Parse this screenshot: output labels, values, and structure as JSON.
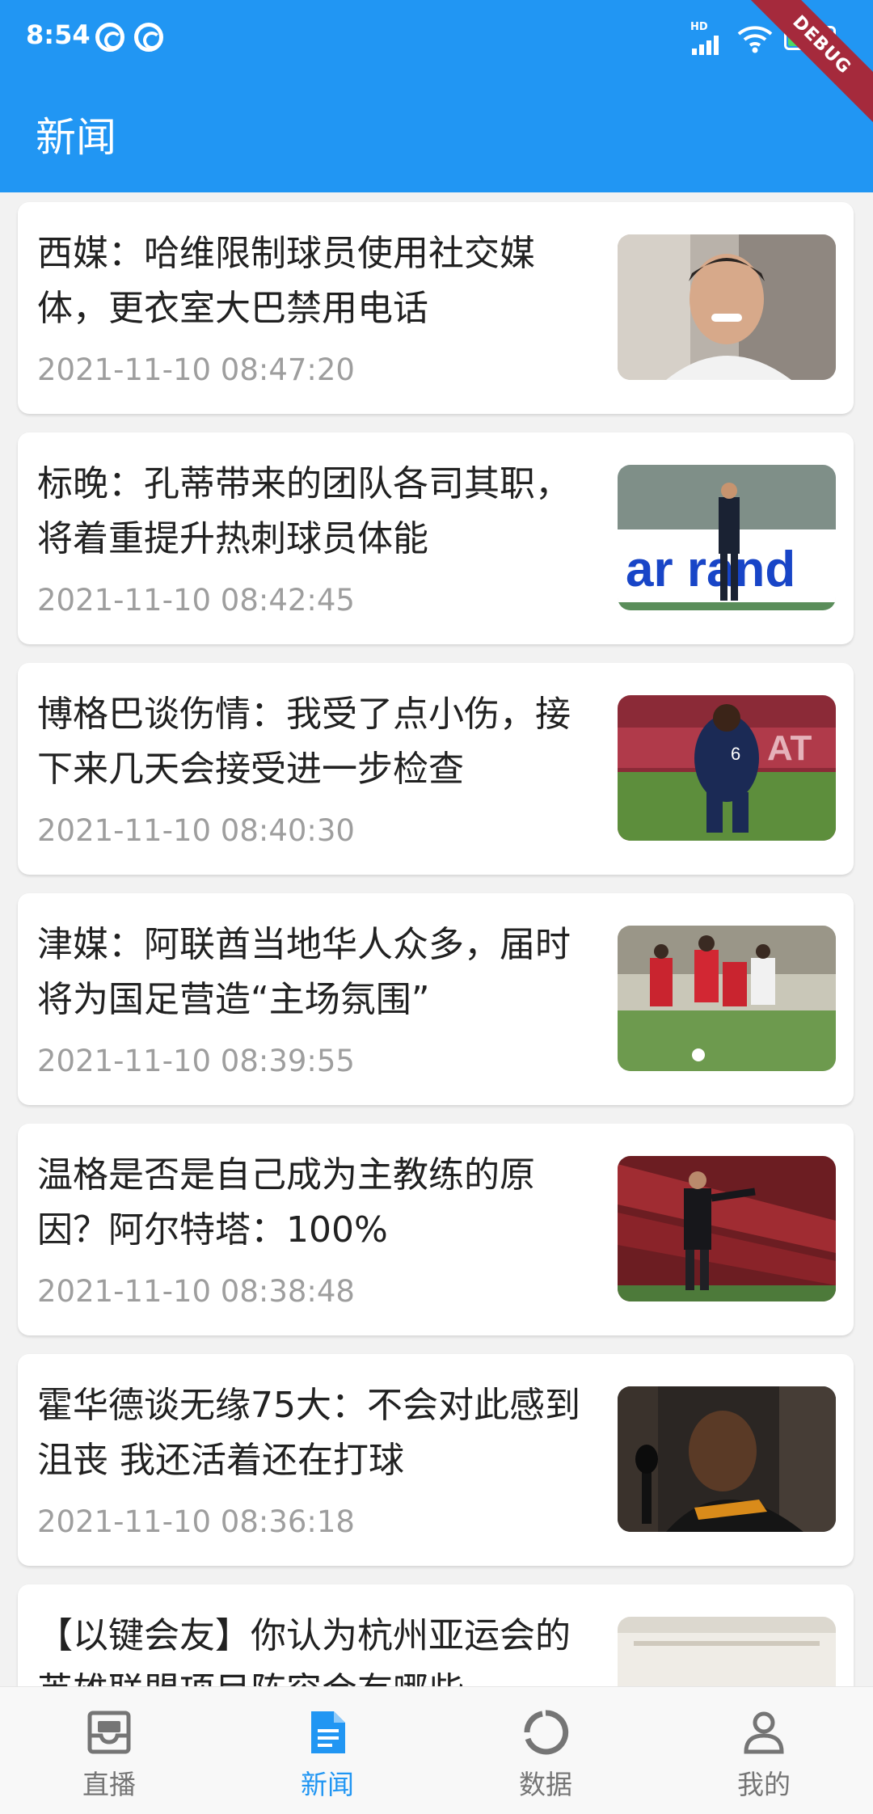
{
  "status_bar": {
    "time": "8:54",
    "network_type": "HD",
    "battery_level": "96"
  },
  "debug_banner": "DEBUG",
  "appbar": {
    "title": "新闻"
  },
  "news": [
    {
      "title": "西媒：哈维限制球员使用社交媒体，更衣室大巴禁用电话",
      "time": "2021-11-10 08:47:20"
    },
    {
      "title": "标晚：孔蒂带来的团队各司其职，将着重提升热刺球员体能",
      "time": "2021-11-10 08:42:45"
    },
    {
      "title": "博格巴谈伤情：我受了点小伤，接下来几天会接受进一步检查",
      "time": "2021-11-10 08:40:30"
    },
    {
      "title": "津媒：阿联酋当地华人众多，届时将为国足营造“主场氛围”",
      "time": "2021-11-10 08:39:55"
    },
    {
      "title": "温格是否是自己成为主教练的原因？阿尔特塔：100%",
      "time": "2021-11-10 08:38:48"
    },
    {
      "title": "霍华德谈无缘75大：不会对此感到沮丧 我还活着还在打球",
      "time": "2021-11-10 08:36:18"
    },
    {
      "title": "【以键会友】你认为杭州亚运会的英雄联盟项目阵容会有哪些",
      "time": ""
    }
  ],
  "bottom_nav": [
    {
      "label": "直播",
      "icon": "inbox-tv-icon",
      "active": false
    },
    {
      "label": "新闻",
      "icon": "document-icon",
      "active": true
    },
    {
      "label": "数据",
      "icon": "ring-chart-icon",
      "active": false
    },
    {
      "label": "我的",
      "icon": "person-icon",
      "active": false
    }
  ],
  "colors": {
    "primary": "#2196f3",
    "inactive": "#757575",
    "timestamp": "#9e9e9e"
  }
}
